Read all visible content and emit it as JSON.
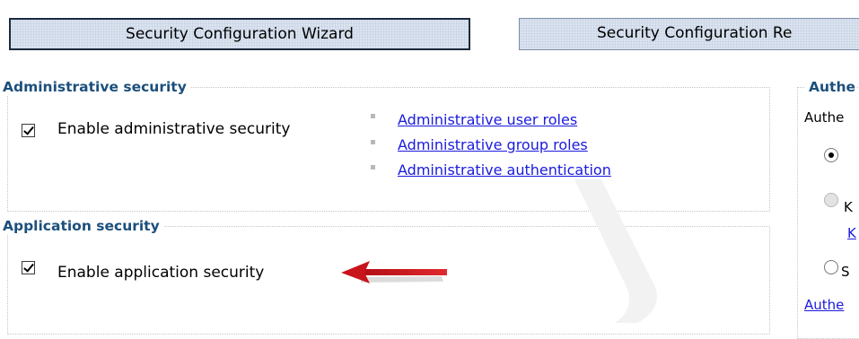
{
  "toolbar": {
    "wizard_label": "Security Configuration Wizard",
    "report_label": "Security Configuration Re"
  },
  "administrative_security": {
    "legend": "Administrative security",
    "checkbox_label": "Enable administrative security",
    "checked": true,
    "links": [
      "Administrative user roles",
      "Administrative group roles",
      "Administrative authentication"
    ]
  },
  "application_security": {
    "legend": "Application security",
    "checkbox_label": "Enable application security",
    "checked": true
  },
  "authentication": {
    "legend": "Authe",
    "label": "Authe",
    "options": [
      {
        "text": "",
        "selected": true,
        "enabled": true
      },
      {
        "text": "K",
        "selected": false,
        "enabled": false
      },
      {
        "text": "S",
        "selected": false,
        "enabled": true
      }
    ],
    "sub_link": "K",
    "bottom_link": "Authe"
  },
  "annotation": {
    "arrow_icon": "red-arrow-icon",
    "arrow_color": "#c8141b"
  },
  "colors": {
    "legend": "#1c4f7c",
    "link": "#1a1add",
    "button_bg": "#dbe4f0"
  }
}
